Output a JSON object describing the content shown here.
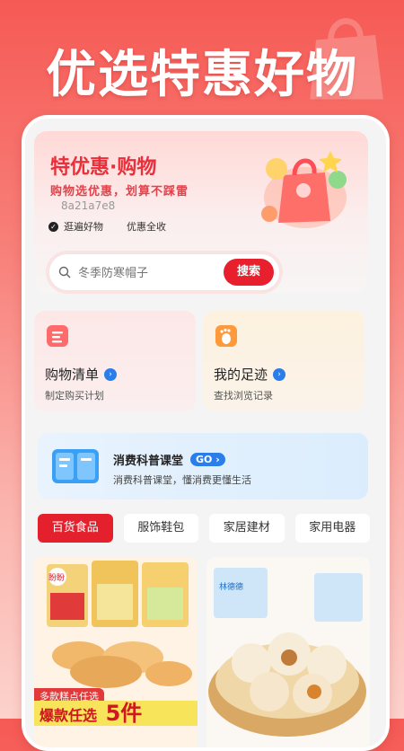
{
  "headline": "优选特惠好物",
  "hero": {
    "title": "特优惠·购物",
    "subtitle": "购物选优惠，划算不踩雷",
    "code": "8a21a7e8",
    "tags": [
      "逛遍好物",
      "优惠全收"
    ]
  },
  "search": {
    "placeholder": "冬季防寒帽子",
    "button_label": "搜索"
  },
  "cards": [
    {
      "title": "购物清单",
      "subtitle": "制定购买计划",
      "icon": "list-icon"
    },
    {
      "title": "我的足迹",
      "subtitle": "查找浏览记录",
      "icon": "footprint-icon"
    }
  ],
  "banner": {
    "title": "消费科普课堂",
    "go_label": "GO",
    "subtitle": "消费科普课堂，懂消费更懂生活"
  },
  "tabs": [
    "百货食品",
    "服饰鞋包",
    "家居建材",
    "家用电器"
  ],
  "products": {
    "p1": {
      "brand": "盼盼",
      "promo_top": "多款糕点任选",
      "promo_main": "爆款任选",
      "promo_count": "5件"
    },
    "p2": {
      "brand": "林德德"
    }
  },
  "colors": {
    "accent_red": "#e8202e",
    "blue": "#2b7de9"
  }
}
